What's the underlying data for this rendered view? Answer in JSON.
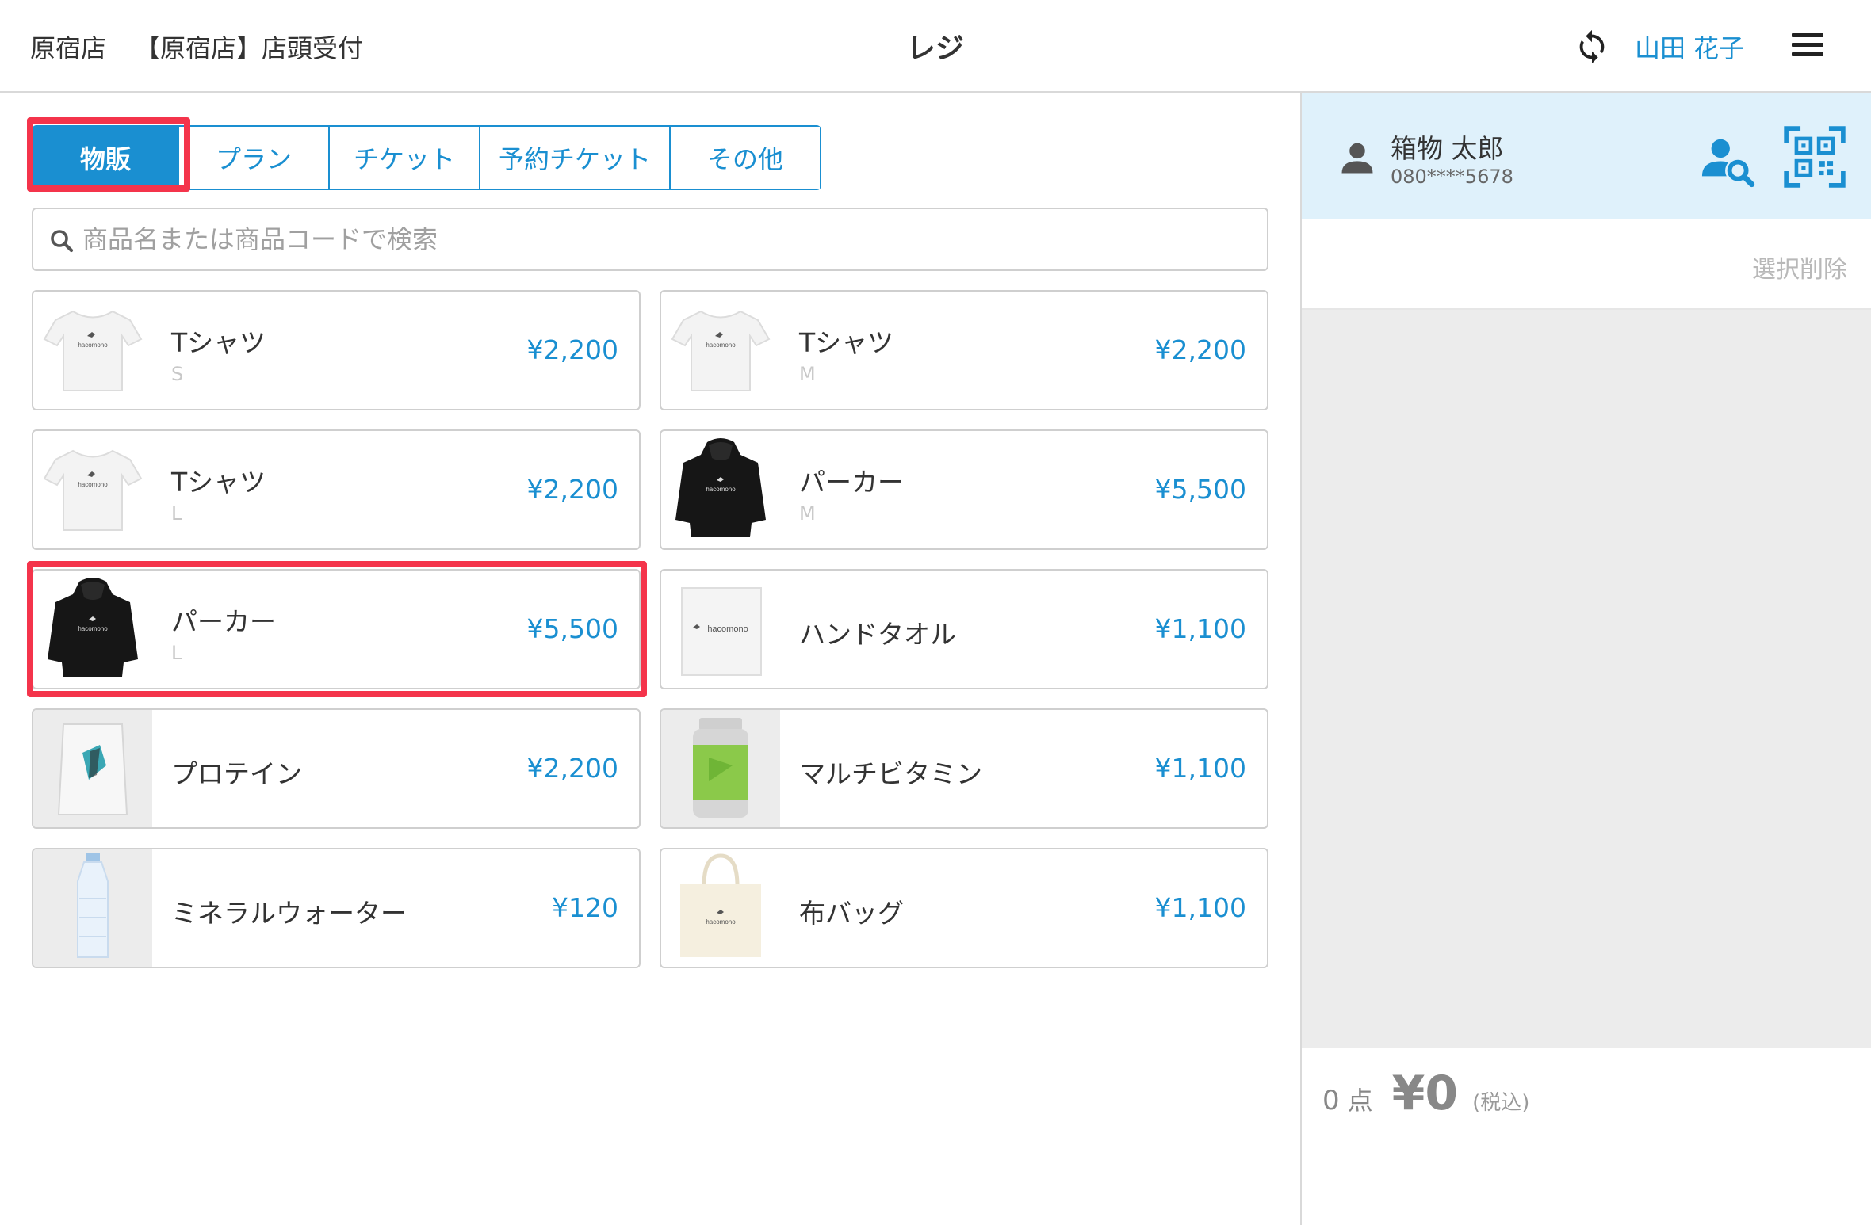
{
  "header": {
    "store": "原宿店",
    "desk": "【原宿店】店頭受付",
    "title": "レジ",
    "staff": "山田 花子"
  },
  "tabs": [
    "物販",
    "プラン",
    "チケット",
    "予約チケット",
    "その他"
  ],
  "active_tab": "物販",
  "search": {
    "placeholder": "商品名または商品コードで検索",
    "value": ""
  },
  "products": [
    {
      "name": "Tシャツ",
      "variant": "S",
      "price": "¥2,200",
      "image": "white-tshirt-hacomono"
    },
    {
      "name": "Tシャツ",
      "variant": "M",
      "price": "¥2,200",
      "image": "white-tshirt-hacomono"
    },
    {
      "name": "Tシャツ",
      "variant": "L",
      "price": "¥2,200",
      "image": "white-tshirt-hacomono"
    },
    {
      "name": "パーカー",
      "variant": "M",
      "price": "¥5,500",
      "image": "black-hoodie-hacomono"
    },
    {
      "name": "パーカー",
      "variant": "L",
      "price": "¥5,500",
      "image": "black-hoodie-hacomono"
    },
    {
      "name": "ハンドタオル",
      "variant": "",
      "price": "¥1,100",
      "image": "hand-towel-hacomono"
    },
    {
      "name": "プロテイン",
      "variant": "",
      "price": "¥2,200",
      "image": "protein-bag"
    },
    {
      "name": "マルチビタミン",
      "variant": "",
      "price": "¥1,100",
      "image": "multivitamin-bottle"
    },
    {
      "name": "ミネラルウォーター",
      "variant": "",
      "price": "¥120",
      "image": "water-bottle"
    },
    {
      "name": "布バッグ",
      "variant": "",
      "price": "¥1,100",
      "image": "tote-bag-hacomono"
    }
  ],
  "highlighted_product_index": 4,
  "customer": {
    "name": "箱物 太郎",
    "phone": "080****5678"
  },
  "cart": {
    "clear_label": "選択削除",
    "count": "0",
    "count_unit": "点",
    "total": "¥0",
    "tax_note": "(税込)"
  },
  "colors": {
    "accent": "#1a8fd1",
    "highlight": "#f4344b",
    "customer_bg": "#dff1fb",
    "cart_bg": "#ececec"
  }
}
